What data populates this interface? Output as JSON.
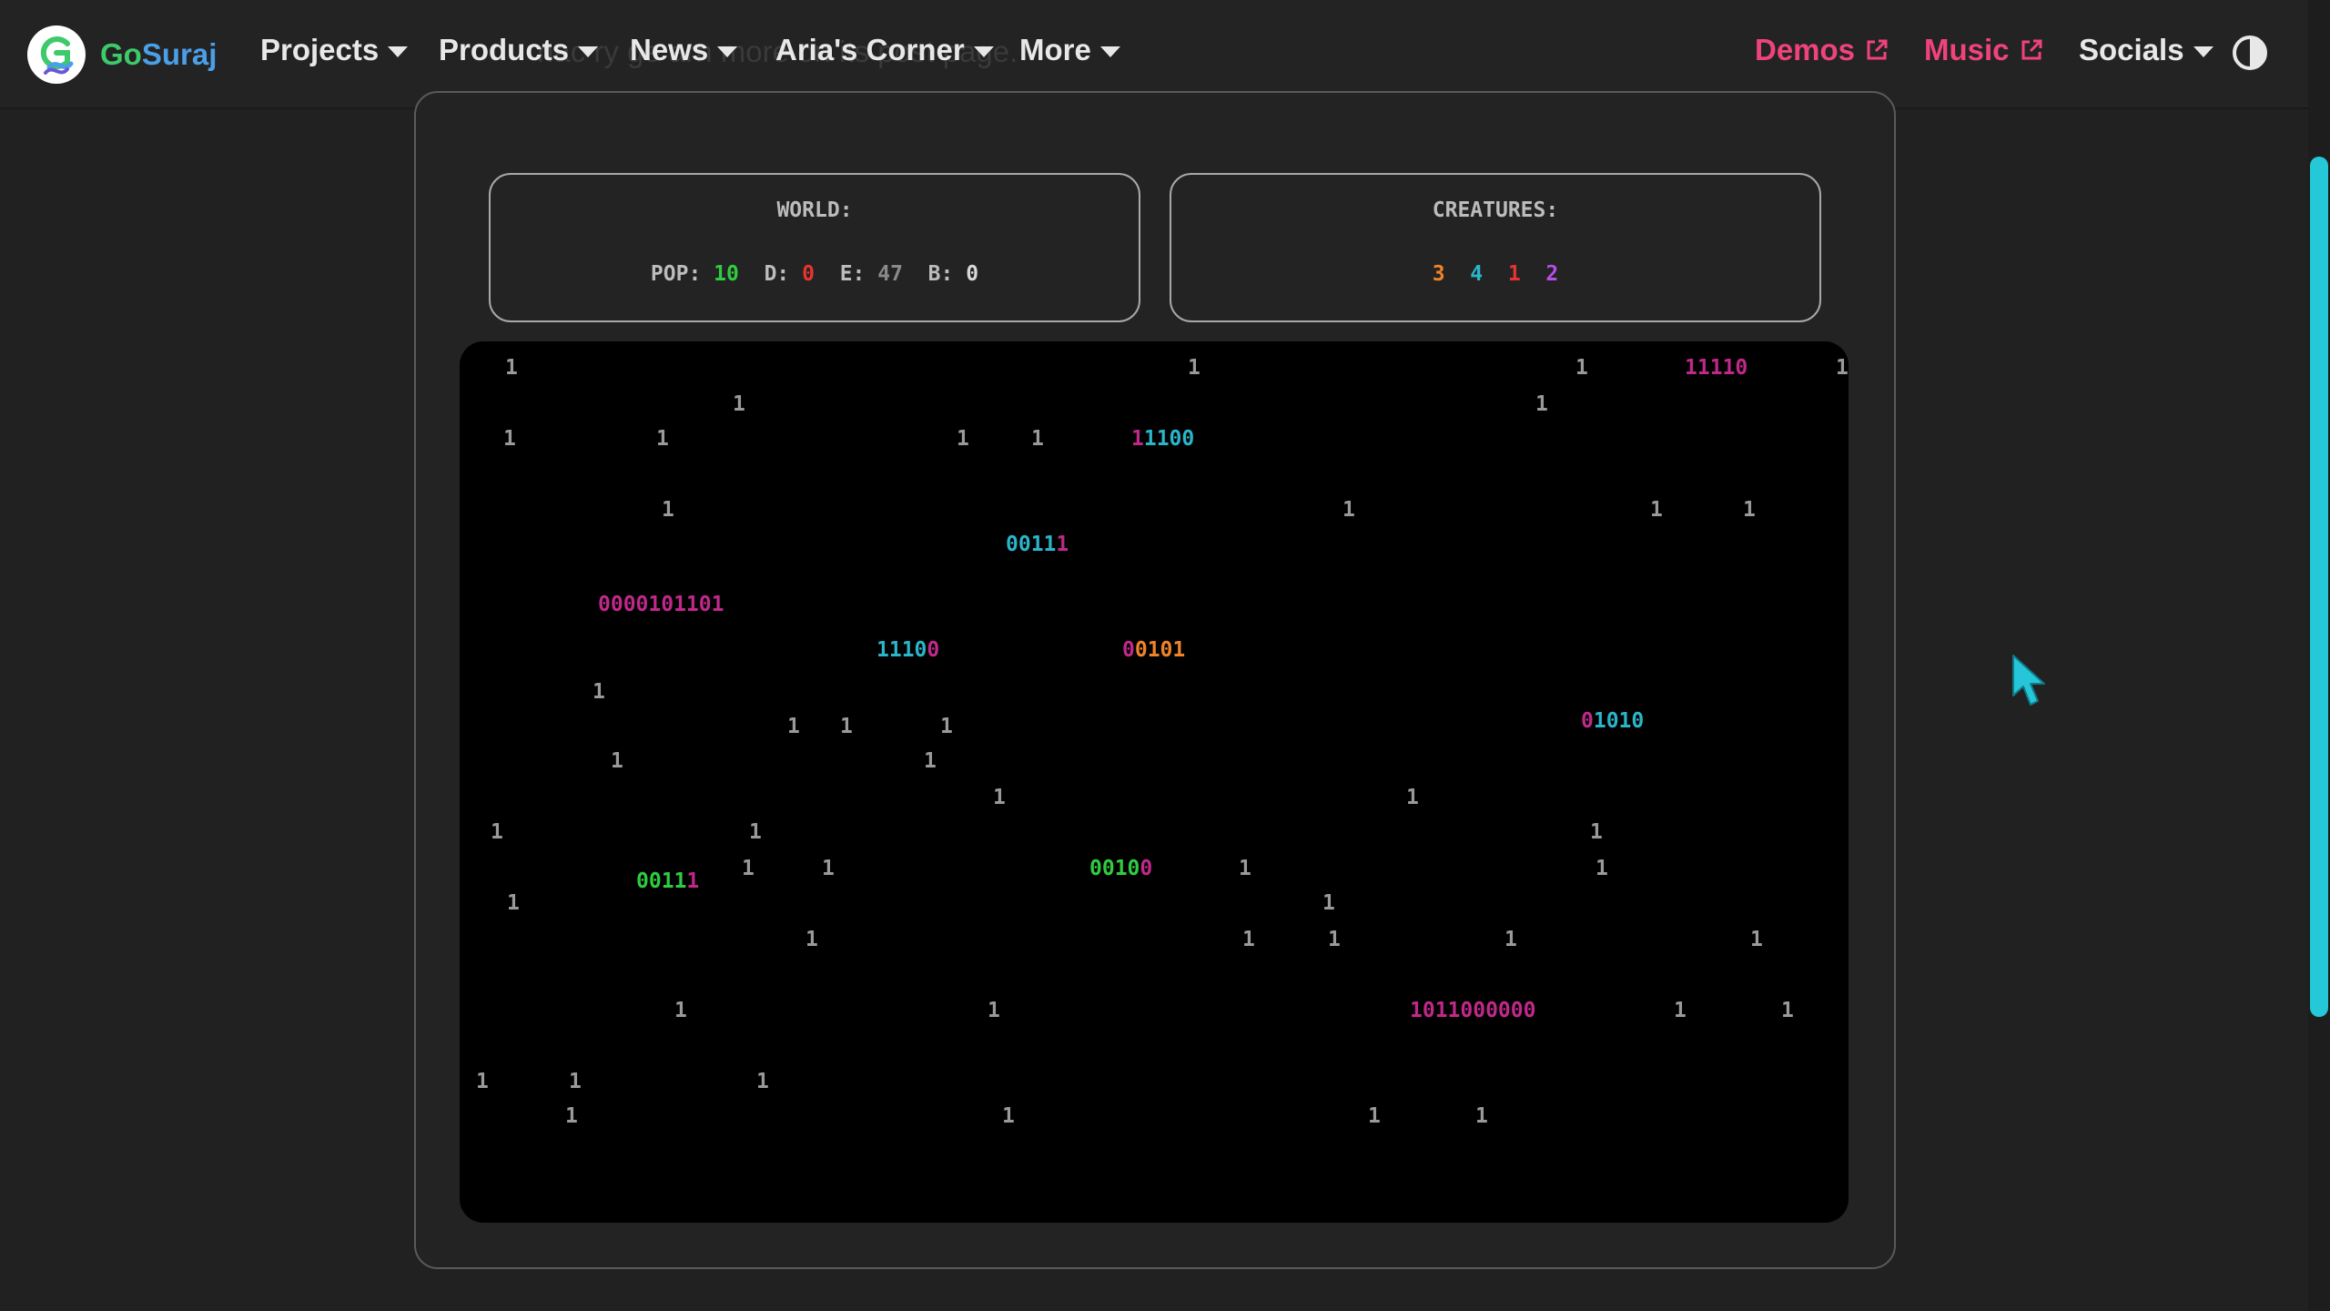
{
  "nav": {
    "brand_go": "Go",
    "brand_suraj": "Suraj",
    "ghost_text": "nac ry ge arn more on its post page.",
    "items": [
      {
        "label": "Projects"
      },
      {
        "label": "Products"
      },
      {
        "label": "News"
      },
      {
        "label": "Aria's Corner"
      },
      {
        "label": "More"
      }
    ],
    "demos": "Demos",
    "music": "Music",
    "socials": "Socials"
  },
  "world": {
    "title": "WORLD:",
    "pop_label": "POP:",
    "pop": "10",
    "d_label": "D:",
    "d": "0",
    "e_label": "E:",
    "e": "47",
    "b_label": "B:",
    "b": "0"
  },
  "creatures": {
    "title": "CREATURES:",
    "counts": [
      {
        "value": "3",
        "color": "#f0832a"
      },
      {
        "value": "4",
        "color": "#2bb5c9"
      },
      {
        "value": "1",
        "color": "#e8342f"
      },
      {
        "value": "2",
        "color": "#b74ee8"
      }
    ]
  },
  "simulation": {
    "food_glyph": "1",
    "creatures": [
      {
        "segments": [
          {
            "t": "11110",
            "c": "#c0288a"
          }
        ]
      },
      {
        "segments": [
          {
            "t": "1",
            "c": "#c0288a"
          },
          {
            "t": "1100",
            "c": "#2bb5c9"
          }
        ]
      },
      {
        "segments": [
          {
            "t": "0011",
            "c": "#2bb5c9"
          },
          {
            "t": "1",
            "c": "#c0288a"
          }
        ]
      },
      {
        "segments": [
          {
            "t": "0000101101",
            "c": "#c0288a"
          }
        ]
      },
      {
        "segments": [
          {
            "t": "1110",
            "c": "#2bb5c9"
          },
          {
            "t": "0",
            "c": "#c0288a"
          }
        ]
      },
      {
        "segments": [
          {
            "t": "0",
            "c": "#c0288a"
          },
          {
            "t": "0101",
            "c": "#f0832a"
          }
        ]
      },
      {
        "segments": [
          {
            "t": "0",
            "c": "#c0288a"
          },
          {
            "t": "1010",
            "c": "#2bb5c9"
          }
        ]
      },
      {
        "segments": [
          {
            "t": "0011",
            "c": "#2ecc40"
          },
          {
            "t": "1",
            "c": "#c0288a"
          }
        ]
      },
      {
        "segments": [
          {
            "t": "0010",
            "c": "#2ecc40"
          },
          {
            "t": "0",
            "c": "#c0288a"
          }
        ]
      },
      {
        "segments": [
          {
            "t": "1011000000",
            "c": "#c0288a"
          }
        ]
      }
    ]
  }
}
